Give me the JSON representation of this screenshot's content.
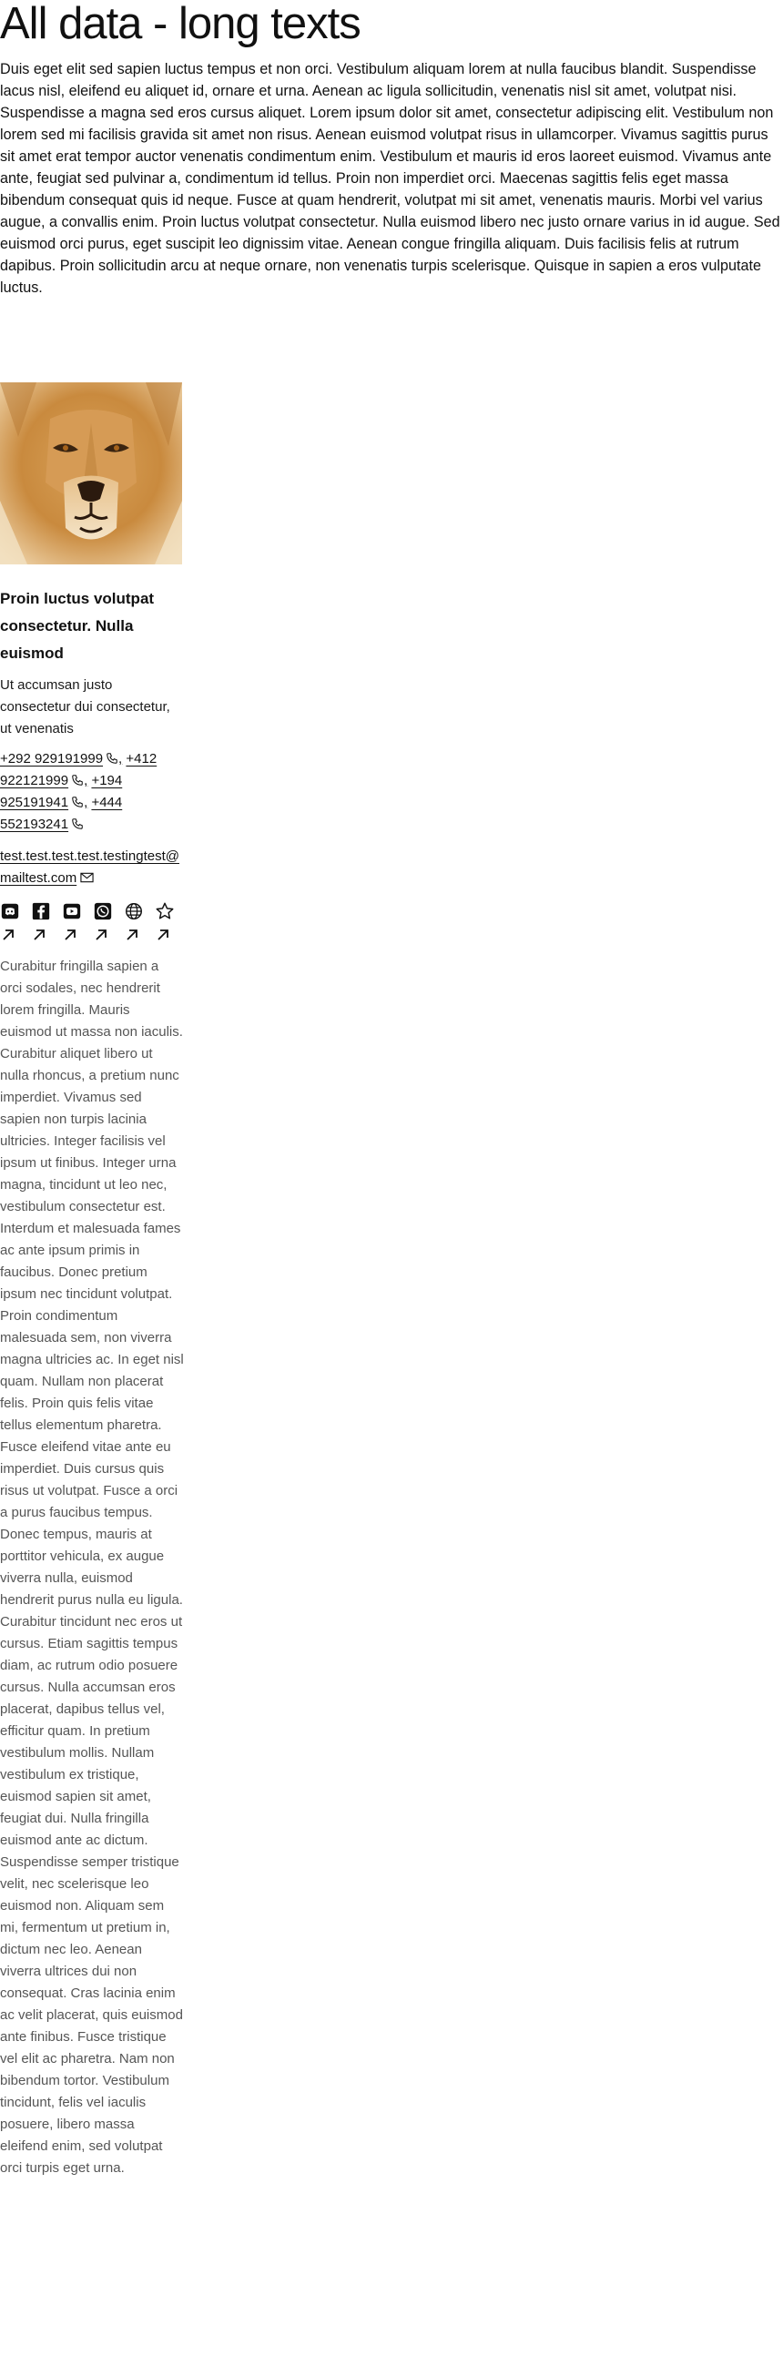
{
  "page": {
    "title": "All data - long texts",
    "intro": "Duis eget elit sed sapien luctus tempus et non orci. Vestibulum aliquam lorem at nulla faucibus blandit. Suspendisse lacus nisl, eleifend eu aliquet id, ornare et urna. Aenean ac ligula sollicitudin, venenatis nisl sit amet, volutpat nisi. Suspendisse a magna sed eros cursus aliquet. Lorem ipsum dolor sit amet, consectetur adipiscing elit. Vestibulum non lorem sed mi facilisis gravida sit amet non risus. Aenean euismod volutpat risus in ullamcorper. Vivamus sagittis purus sit amet erat tempor auctor venenatis condimentum enim. Vestibulum et mauris id eros laoreet euismod. Vivamus ante ante, feugiat sed pulvinar a, condimentum id tellus. Proin non imperdiet orci. Maecenas sagittis felis eget massa bibendum consequat quis id neque. Fusce at quam hendrerit, volutpat mi sit amet, venenatis mauris. Morbi vel varius augue, a convallis enim. Proin luctus volutpat consectetur. Nulla euismod libero nec justo ornare varius in id augue. Sed euismod orci purus, eget suscipit leo dignissim vitae. Aenean congue fringilla aliquam. Duis facilisis felis at rutrum dapibus. Proin sollicitudin arcu at neque ornare, non venenatis turpis scelerisque. Quisque in sapien a eros vulputate luctus."
  },
  "card": {
    "image_icon": "lion-portrait",
    "title": "Proin luctus volutpat consectetur. Nulla euismod",
    "subtitle": "Ut accumsan justo consectetur dui consectetur, ut venenatis",
    "phones": [
      "+292 929191999",
      "+412 922121999",
      "+194 925191941",
      "+444 552193241"
    ],
    "phone_separator": ",",
    "email": "test.test.test.test.testingtest@mailtest.com",
    "socials": [
      {
        "icon": "discord-icon"
      },
      {
        "icon": "facebook-icon"
      },
      {
        "icon": "youtube-icon"
      },
      {
        "icon": "whatsapp-icon"
      },
      {
        "icon": "globe-icon"
      },
      {
        "icon": "star-icon"
      }
    ],
    "description": "Curabitur fringilla sapien a orci sodales, nec hendrerit lorem fringilla. Mauris euismod ut massa non iaculis. Curabitur aliquet libero ut nulla rhoncus, a pretium nunc imperdiet. Vivamus sed sapien non turpis lacinia ultricies. Integer facilisis vel ipsum ut finibus. Integer urna magna, tincidunt ut leo nec, vestibulum consectetur est. Interdum et malesuada fames ac ante ipsum primis in faucibus. Donec pretium ipsum nec tincidunt volutpat. Proin condimentum malesuada sem, non viverra magna ultricies ac. In eget nisl quam. Nullam non placerat felis. Proin quis felis vitae tellus elementum pharetra. Fusce eleifend vitae ante eu imperdiet. Duis cursus quis risus ut volutpat. Fusce a orci a purus faucibus tempus. Donec tempus, mauris at porttitor vehicula, ex augue viverra nulla, euismod hendrerit purus nulla eu ligula. Curabitur tincidunt nec eros ut cursus. Etiam sagittis tempus diam, ac rutrum odio posuere cursus. Nulla accumsan eros placerat, dapibus tellus vel, efficitur quam. In pretium vestibulum mollis. Nullam vestibulum ex tristique, euismod sapien sit amet, feugiat dui. Nulla fringilla euismod ante ac dictum. Suspendisse semper tristique velit, nec scelerisque leo euismod non. Aliquam sem mi, fermentum ut pretium in, dictum nec leo. Aenean viverra ultrices dui non consequat. Cras lacinia enim ac velit placerat, quis euismod ante finibus. Fusce tristique vel elit ac pharetra. Nam non bibendum tortor. Vestibulum tincidunt, felis vel iaculis posuere, libero massa eleifend enim, sed volutpat orci turpis eget urna."
  }
}
